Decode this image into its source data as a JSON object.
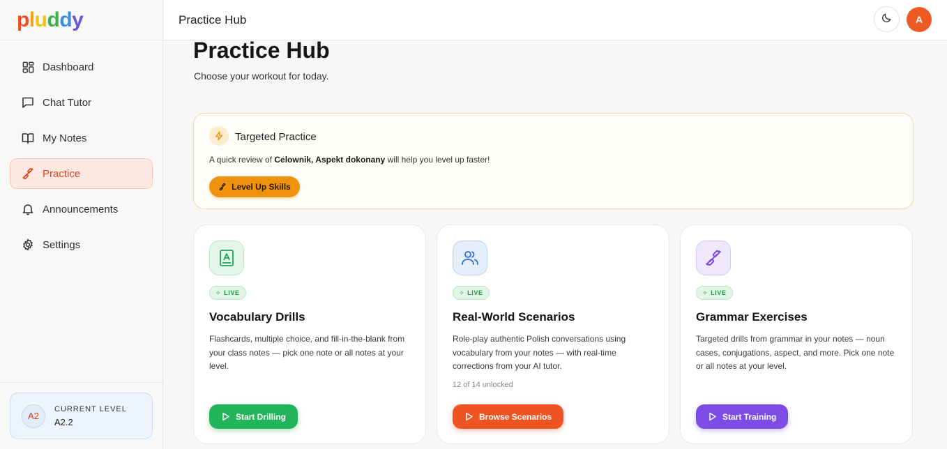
{
  "app": {
    "logo_letters": [
      "p",
      "l",
      "u",
      "d",
      "d",
      "y"
    ],
    "logo_colors": [
      "#ef4b25",
      "#f2a21c",
      "#f2c21a",
      "#3cb04a",
      "#3d8ee0",
      "#6a55d8"
    ]
  },
  "sidebar": {
    "items": [
      {
        "label": "Dashboard",
        "icon": "dashboard-icon"
      },
      {
        "label": "Chat Tutor",
        "icon": "chat-icon"
      },
      {
        "label": "My Notes",
        "icon": "book-icon"
      },
      {
        "label": "Practice",
        "icon": "dumbbell-icon"
      },
      {
        "label": "Announcements",
        "icon": "bell-icon"
      },
      {
        "label": "Settings",
        "icon": "gear-icon"
      }
    ],
    "active_label": "Practice",
    "level": {
      "badge": "A2",
      "label": "CURRENT LEVEL",
      "value": "A2.2"
    }
  },
  "header": {
    "title": "Practice Hub",
    "user_initial": "A",
    "theme_icon": "moon-icon"
  },
  "main": {
    "title": "Practice Hub",
    "subtitle": "Choose your workout for today.",
    "targeted": {
      "title": "Targeted Practice",
      "text_prefix": "A quick review of ",
      "text_topics": "Celownik, Aspekt dokonany",
      "text_suffix": " will help you level up faster!",
      "button_label": "Level Up Skills",
      "icon": "lightning-icon"
    },
    "cards": [
      {
        "title": "Vocabulary Drills",
        "badge": "LIVE",
        "description": "Flashcards, multiple choice, and fill-in-the-blank from your class notes — pick one note or all notes at your level.",
        "note": "",
        "button_label": "Start Drilling",
        "icon": "flashcard-icon",
        "accent": "#22b45a"
      },
      {
        "title": "Real-World Scenarios",
        "badge": "LIVE",
        "description": "Role-play authentic Polish conversations using vocabulary from your notes — with real-time corrections from your AI tutor.",
        "note": "12 of 14 unlocked",
        "button_label": "Browse Scenarios",
        "icon": "users-icon",
        "accent": "#ee5322"
      },
      {
        "title": "Grammar Exercises",
        "badge": "LIVE",
        "description": "Targeted drills from grammar in your notes — noun cases, conjugations, aspect, and more. Pick one note or all notes at your level.",
        "note": "",
        "button_label": "Start Training",
        "icon": "dumbbell-icon",
        "accent": "#7c4ce6"
      }
    ]
  }
}
